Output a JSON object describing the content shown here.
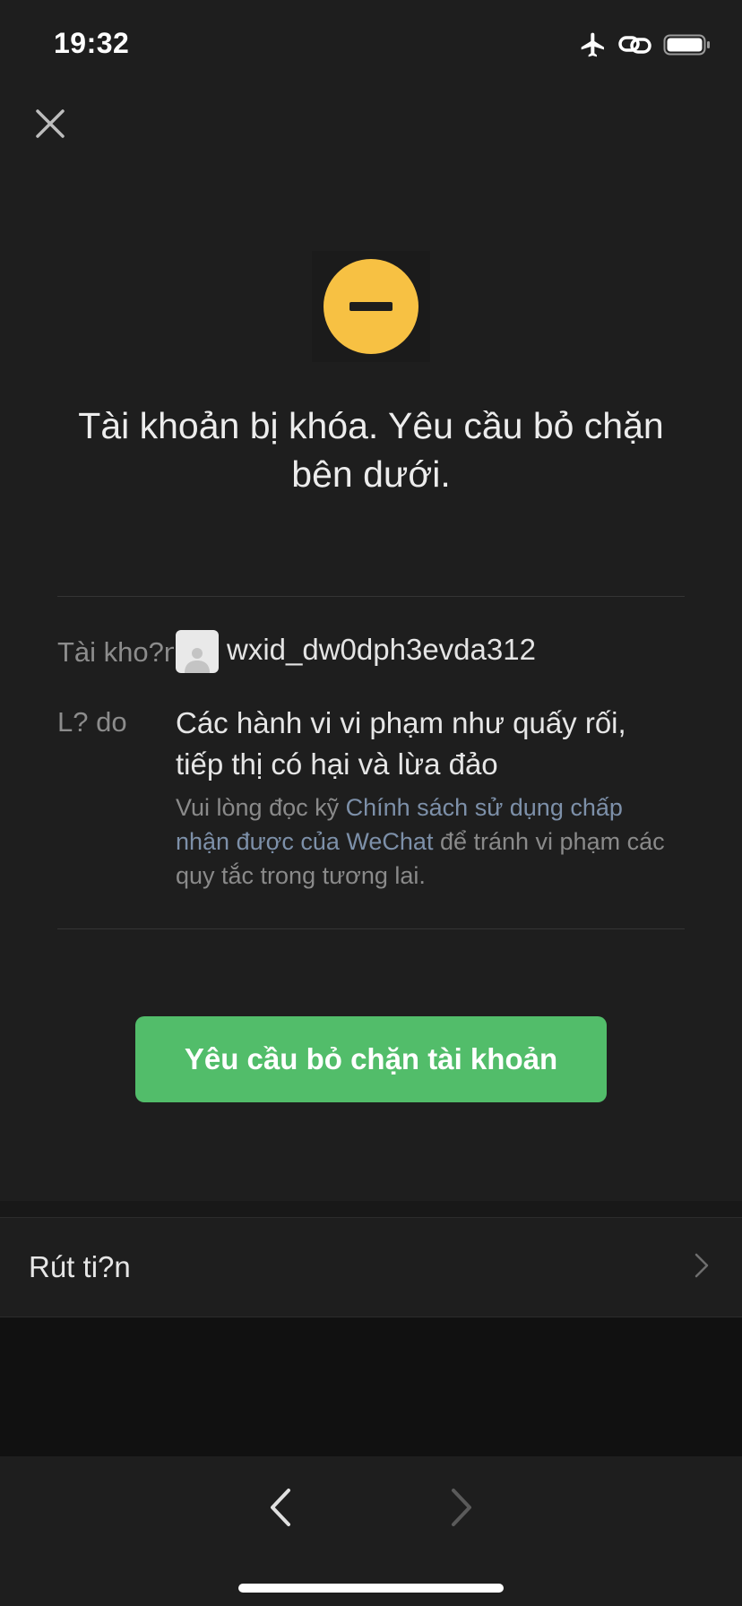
{
  "status_bar": {
    "time": "19:32",
    "icons": [
      "airplane-mode-icon",
      "link-icon",
      "battery-icon"
    ]
  },
  "header": {
    "close_icon": "close-icon"
  },
  "notice": {
    "icon": "minus-circle-icon",
    "icon_color": "#f7c143",
    "title": "Tài khoản bị khóa. Yêu cầu bỏ chặn bên dưới."
  },
  "details": {
    "account_label": "Tài kho?n",
    "account_id": "wxid_dw0dph3evda312",
    "reason_label": "L? do",
    "reason_text": "Các hành vi vi phạm như quấy rối, tiếp thị có hại và lừa đảo",
    "note_prefix": "Vui lòng đọc kỹ ",
    "note_link": "Chính sách sử dụng chấp nhận được của WeChat",
    "note_suffix": " để tránh vi phạm các quy tắc trong tương lai."
  },
  "actions": {
    "unblock_button": "Yêu cầu bỏ chặn tài khoản",
    "button_color": "#52bd6a",
    "link_color": "#7d90a9"
  },
  "withdraw": {
    "label": "Rút ti?n"
  },
  "toolbar": {
    "back_icon": "chevron-left-icon",
    "forward_icon": "chevron-right-icon"
  }
}
